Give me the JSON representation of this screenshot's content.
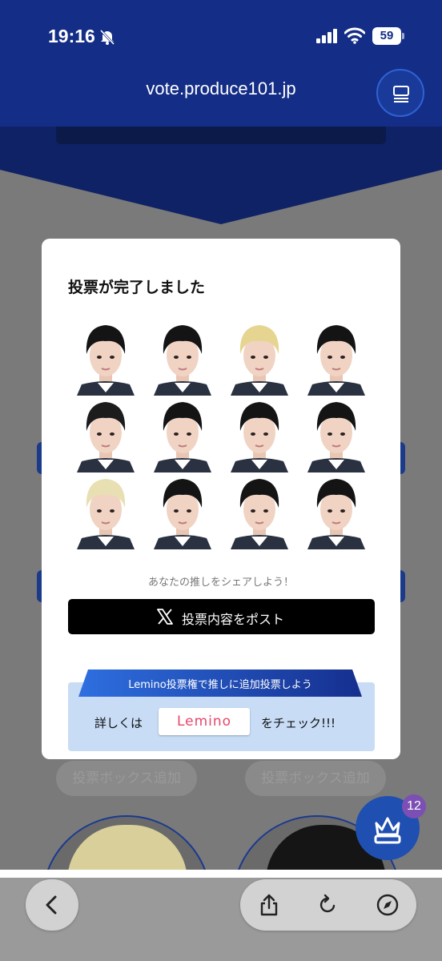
{
  "status_bar": {
    "time": "19:16",
    "battery": "59"
  },
  "browser": {
    "url": "vote.produce101.jp"
  },
  "modal": {
    "title": "投票が完了しました",
    "share_text": "あなたの推しをシェアしよう！",
    "post_button": "投票内容をポスト",
    "lemino_banner": "Lemino投票権で推しに追加投票しよう",
    "detail_prefix": "詳しくは",
    "lemino_logo": "Lemino",
    "detail_suffix": "をチェック!!!"
  },
  "background": {
    "add_box_left": "投票ボックス追加",
    "add_box_right": "投票ボックス追加",
    "ranking_badge": "12"
  },
  "colors": {
    "header": "#142d86",
    "accent": "#2f62d4",
    "lemino_pink": "#e8456a",
    "lemino_bg": "#c8dcf6"
  },
  "icons": {
    "bell": "bell-slash-icon",
    "menu": "tabs-icon",
    "x": "x-logo-icon",
    "back": "chevron-left-icon",
    "share": "share-icon",
    "reload": "reload-icon",
    "compass": "compass-icon",
    "crown": "crown-icon"
  }
}
